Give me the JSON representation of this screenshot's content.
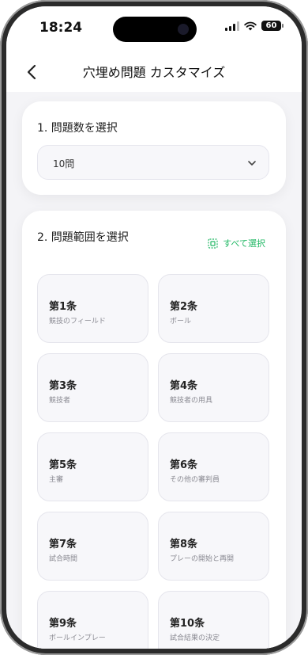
{
  "status": {
    "time": "18:24",
    "battery": "60"
  },
  "nav": {
    "title": "穴埋め問題 カスタマイズ"
  },
  "section1": {
    "title": "1. 問題数を選択",
    "selected": "10問"
  },
  "section2": {
    "title": "2. 問題範囲を選択",
    "select_all": "すべて選択",
    "items": [
      {
        "num": "第1条",
        "name": "競技のフィールド"
      },
      {
        "num": "第2条",
        "name": "ボール"
      },
      {
        "num": "第3条",
        "name": "競技者"
      },
      {
        "num": "第4条",
        "name": "競技者の用具"
      },
      {
        "num": "第5条",
        "name": "主審"
      },
      {
        "num": "第6条",
        "name": "その他の審判員"
      },
      {
        "num": "第7条",
        "name": "試合時間"
      },
      {
        "num": "第8条",
        "name": "プレーの開始と再開"
      },
      {
        "num": "第9条",
        "name": "ボールインプレー"
      },
      {
        "num": "第10条",
        "name": "試合結果の決定"
      }
    ]
  },
  "colors": {
    "accent": "#22b865",
    "background": "#f4f4f7"
  }
}
